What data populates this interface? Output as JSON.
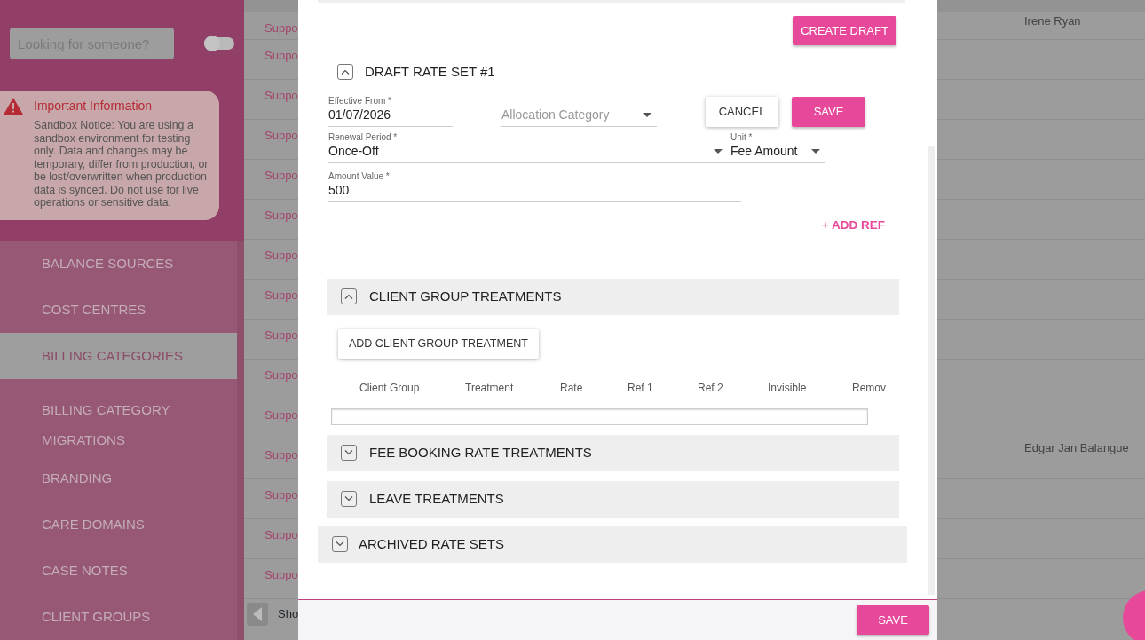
{
  "sidebar": {
    "search": {
      "placeholder": "Looking for someone?"
    },
    "toggle": {
      "on": false
    },
    "notice": {
      "title": "Important Information",
      "text": "Sandbox Notice: You are using a sandbox environment for testing only. Data and changes may be temporary, differ from production, or be lost/overwritten when production data is synced. Do not use for live operations or sensitive data."
    },
    "items": [
      {
        "label": "BALANCE SOURCES",
        "selected": false
      },
      {
        "label": "COST CENTRES",
        "selected": false
      },
      {
        "label": "BILLING CATEGORIES",
        "selected": true
      },
      {
        "label": "BILLING CATEGORY MIGRATIONS",
        "selected": false
      },
      {
        "label": "BRANDING",
        "selected": false
      },
      {
        "label": "CARE DOMAINS",
        "selected": false
      },
      {
        "label": "CASE NOTES",
        "selected": false
      },
      {
        "label": "CLIENT GROUPS",
        "selected": false
      }
    ]
  },
  "background_table": {
    "rows": [
      {
        "column_1": "Suppo",
        "column_2": "Irene Ryan"
      },
      {
        "column_1": "Suppo"
      },
      {
        "column_1": "Suppo"
      },
      {
        "column_1": "Suppo"
      },
      {
        "column_1": "Suppo"
      },
      {
        "column_1": "Suppo"
      },
      {
        "column_1": "Suppo"
      },
      {
        "column_1": "Suppo"
      },
      {
        "column_1": "Suppo"
      },
      {
        "column_1": "Suppo"
      },
      {
        "column_1": "Suppo"
      },
      {
        "column_1": "Suppo",
        "column_2": "Edgar Jan Balangue"
      },
      {
        "column_1": "Suppo"
      },
      {
        "column_1": "Suppo"
      },
      {
        "column_1": "Suppo"
      }
    ],
    "pager": {
      "text": "Sho"
    }
  },
  "dialog": {
    "create_draft": "CREATE DRAFT",
    "rate_set": {
      "title": "DRAFT RATE SET #1",
      "expanded": true,
      "fields": [
        {
          "kind": "text",
          "label": "Effective From *",
          "value": "01/07/2026"
        },
        {
          "kind": "select",
          "placeholder": "Allocation Category"
        },
        {
          "kind": "select",
          "label": "Renewal Period *",
          "value": "Once-Off"
        },
        {
          "kind": "select",
          "label": "Unit *",
          "value": "Fee Amount"
        },
        {
          "kind": "text",
          "label": "Amount Value *",
          "value": "500"
        }
      ],
      "cancel": "CANCEL",
      "save": "SAVE",
      "add_ref": "+ ADD REF",
      "sections": [
        {
          "title": "CLIENT GROUP TREATMENTS",
          "expanded": true,
          "add_button": "ADD CLIENT GROUP TREATMENT",
          "columns": [
            "Client Group",
            "Treatment",
            "Rate",
            "Ref 1",
            "Ref 2",
            "Invisible",
            "Remov"
          ]
        },
        {
          "title": "FEE BOOKING RATE TREATMENTS",
          "expanded": false
        },
        {
          "title": "LEAVE TREATMENTS",
          "expanded": false
        }
      ]
    },
    "archived": {
      "title": "ARCHIVED RATE SETS",
      "expanded": false
    },
    "footer_save": "SAVE"
  }
}
